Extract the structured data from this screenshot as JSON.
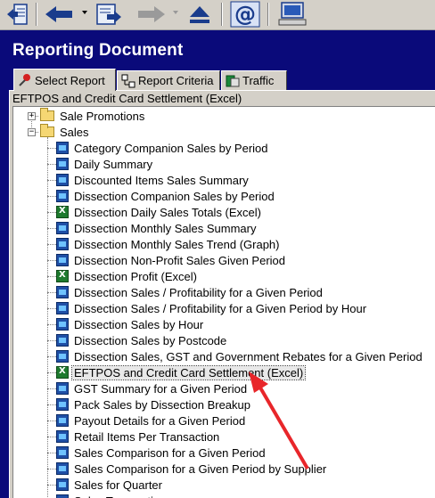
{
  "toolbar": {
    "buttons": [
      {
        "name": "exit-report-icon"
      },
      {
        "name": "back-icon"
      },
      {
        "name": "run-report-icon"
      },
      {
        "name": "forward-icon"
      },
      {
        "name": "eject-icon"
      },
      {
        "name": "email-icon"
      },
      {
        "name": "computer-icon"
      }
    ]
  },
  "header": {
    "title": "Reporting Document"
  },
  "tabs": [
    {
      "label": "Select Report",
      "icon": "pin-icon",
      "active": true
    },
    {
      "label": "Report Criteria",
      "icon": "criteria-icon",
      "active": false
    },
    {
      "label": "Traffic",
      "icon": "traffic-icon",
      "active": false
    }
  ],
  "selected_report": "EFTPOS and Credit Card Settlement (Excel)",
  "tree": {
    "folders": [
      {
        "label": "Sale Promotions",
        "expanded": false
      },
      {
        "label": "Sales",
        "expanded": true
      }
    ],
    "sales_items": [
      {
        "label": "Category Companion Sales by Period",
        "type": "report"
      },
      {
        "label": "Daily Summary",
        "type": "report"
      },
      {
        "label": "Discounted Items Sales Summary",
        "type": "report"
      },
      {
        "label": "Dissection Companion Sales by Period",
        "type": "report"
      },
      {
        "label": "Dissection Daily Sales Totals (Excel)",
        "type": "excel"
      },
      {
        "label": "Dissection Monthly Sales Summary",
        "type": "report"
      },
      {
        "label": "Dissection Monthly Sales Trend (Graph)",
        "type": "report"
      },
      {
        "label": "Dissection Non-Profit Sales Given Period",
        "type": "report"
      },
      {
        "label": "Dissection Profit (Excel)",
        "type": "excel"
      },
      {
        "label": "Dissection Sales / Profitability for a Given Period",
        "type": "report"
      },
      {
        "label": "Dissection Sales / Profitability for a Given Period by Hour",
        "type": "report"
      },
      {
        "label": "Dissection Sales by Hour",
        "type": "report"
      },
      {
        "label": "Dissection Sales by Postcode",
        "type": "report"
      },
      {
        "label": "Dissection Sales, GST and Government Rebates for a Given Period",
        "type": "report"
      },
      {
        "label": "EFTPOS and Credit Card Settlement (Excel)",
        "type": "excel",
        "highlighted": true
      },
      {
        "label": "GST Summary for a Given Period",
        "type": "report"
      },
      {
        "label": "Pack Sales by Dissection Breakup",
        "type": "report"
      },
      {
        "label": "Payout Details for a Given Period",
        "type": "report"
      },
      {
        "label": "Retail Items Per Transaction",
        "type": "report"
      },
      {
        "label": "Sales Comparison for a Given Period",
        "type": "report"
      },
      {
        "label": "Sales Comparison for a Given Period by Supplier",
        "type": "report"
      },
      {
        "label": "Sales for Quarter",
        "type": "report"
      },
      {
        "label": "Sales Transactions",
        "type": "report"
      }
    ]
  },
  "annotation": {
    "name": "red-arrow-icon",
    "color": "#e8262a"
  },
  "colors": {
    "header_bg": "#0a0a7a",
    "panel_bg": "#d4d0c8"
  }
}
